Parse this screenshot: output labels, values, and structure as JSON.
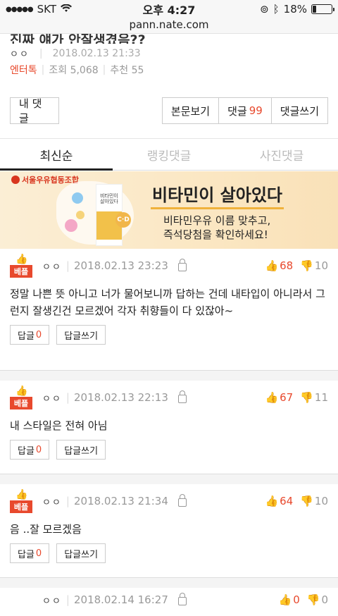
{
  "status_bar": {
    "carrier": "SKT",
    "time": "오후 4:27",
    "battery_percent": "18%",
    "battery_level": 0.18
  },
  "url": "pann.nate.com",
  "article": {
    "title": "진짜 얘가 안잘생겼음??",
    "author": "ㅇㅇ",
    "date": "2018.02.13 21:33",
    "category": "엔터톡",
    "views": "조회 5,068",
    "recommends": "추천 55"
  },
  "buttons": {
    "my_comments": "내 댓글",
    "view_post": "본문보기",
    "comments_label": "댓글",
    "comments_count": "99",
    "write_comment": "댓글쓰기"
  },
  "tabs": [
    {
      "label": "최신순",
      "active": true
    },
    {
      "label": "랭킹댓글",
      "active": false
    },
    {
      "label": "사진댓글",
      "active": false
    }
  ],
  "ad": {
    "brand": "서울우유협동조합",
    "carton_text": "비타민이 살아있다",
    "title": "비타민이 살아있다",
    "line1": "비타민우유 이름 맞추고,",
    "line2": "즉석당첨을 확인하세요!"
  },
  "comments": [
    {
      "badge": "베플",
      "author": "ㅇㅇ",
      "date": "2018.02.13 23:23",
      "up": "68",
      "down": "10",
      "text": "정말 나쁜 뜻 아니고 너가 물어보니까 답하는 건데 내타입이 아니라서 그런지 잘생긴건 모르겠어 각자 취향들이 다 있잖아~",
      "reply_label": "답글",
      "reply_count": "0",
      "write_reply": "답글쓰기"
    },
    {
      "badge": "베플",
      "author": "ㅇㅇ",
      "date": "2018.02.13 22:13",
      "up": "67",
      "down": "11",
      "text": "내 스타일은 전혀 아님",
      "reply_label": "답글",
      "reply_count": "0",
      "write_reply": "답글쓰기"
    },
    {
      "badge": "베플",
      "author": "ㅇㅇ",
      "date": "2018.02.13 21:34",
      "up": "64",
      "down": "10",
      "text": "음 ..잘 모르겠음",
      "reply_label": "답글",
      "reply_count": "0",
      "write_reply": "답글쓰기"
    },
    {
      "author": "ㅇㅇ",
      "date": "2018.02.14 16:27",
      "up": "0",
      "down": "0"
    }
  ]
}
